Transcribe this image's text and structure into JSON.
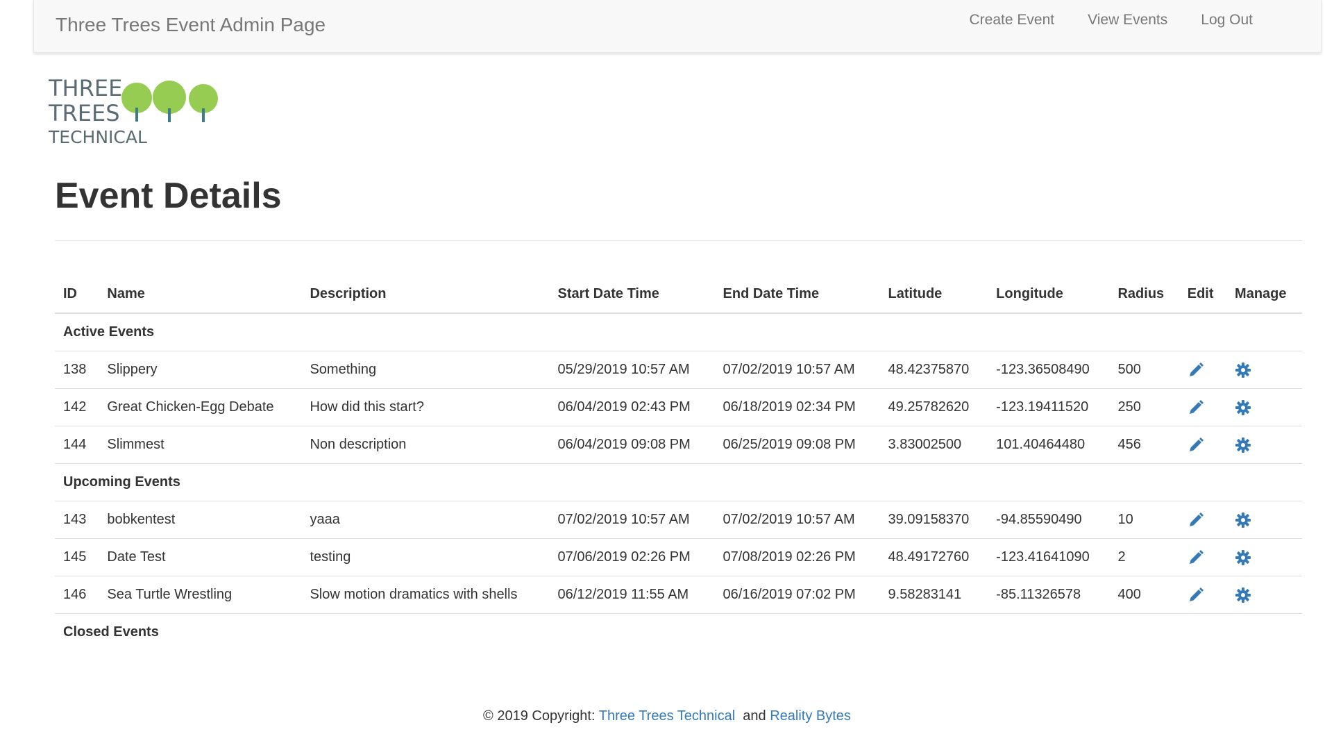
{
  "navbar": {
    "brand": "Three Trees Event Admin Page",
    "links": [
      "Create Event",
      "View Events",
      "Log Out"
    ]
  },
  "logo": {
    "line1": "THREE",
    "line2": "TREES",
    "line3": "TECHNICAL",
    "tree_color": "#8cc63f",
    "text_color": "#5b6b73"
  },
  "page": {
    "title": "Event Details"
  },
  "table": {
    "headers": [
      "ID",
      "Name",
      "Description",
      "Start Date Time",
      "End Date Time",
      "Latitude",
      "Longitude",
      "Radius",
      "Edit",
      "Manage"
    ],
    "groups": [
      {
        "label": "Active Events",
        "rows": [
          {
            "id": "138",
            "name": "Slippery",
            "description": "Something",
            "start": "05/29/2019 10:57 AM",
            "end": "07/02/2019 10:57 AM",
            "latitude": "48.42375870",
            "longitude": "-123.36508490",
            "radius": "500"
          },
          {
            "id": "142",
            "name": "Great Chicken-Egg Debate",
            "description": "How did this start?",
            "start": "06/04/2019 02:43 PM",
            "end": "06/18/2019 02:34 PM",
            "latitude": "49.25782620",
            "longitude": "-123.19411520",
            "radius": "250"
          },
          {
            "id": "144",
            "name": "Slimmest",
            "description": "Non description",
            "start": "06/04/2019 09:08 PM",
            "end": "06/25/2019 09:08 PM",
            "latitude": "3.83002500",
            "longitude": "101.40464480",
            "radius": "456"
          }
        ]
      },
      {
        "label": "Upcoming Events",
        "rows": [
          {
            "id": "143",
            "name": "bobkentest",
            "description": "yaaa",
            "start": "07/02/2019 10:57 AM",
            "end": "07/02/2019 10:57 AM",
            "latitude": "39.09158370",
            "longitude": "-94.85590490",
            "radius": "10"
          },
          {
            "id": "145",
            "name": "Date Test",
            "description": "testing",
            "start": "07/06/2019 02:26 PM",
            "end": "07/08/2019 02:26 PM",
            "latitude": "48.49172760",
            "longitude": "-123.41641090",
            "radius": "2"
          },
          {
            "id": "146",
            "name": "Sea Turtle Wrestling",
            "description": "Slow motion dramatics with shells",
            "start": "06/12/2019 11:55 AM",
            "end": "06/16/2019 07:02 PM",
            "latitude": "9.58283141",
            "longitude": "-85.11326578",
            "radius": "400"
          }
        ]
      },
      {
        "label": "Closed Events",
        "rows": []
      }
    ],
    "edit_icon": "pencil-icon",
    "manage_icon": "gear-icon",
    "icon_color": "#337ab7"
  },
  "footer": {
    "prefix": "© 2019 Copyright:",
    "link1": "Three Trees Technical",
    "middle": "and",
    "link2": "Reality Bytes",
    "link_color": "#337ab7"
  }
}
